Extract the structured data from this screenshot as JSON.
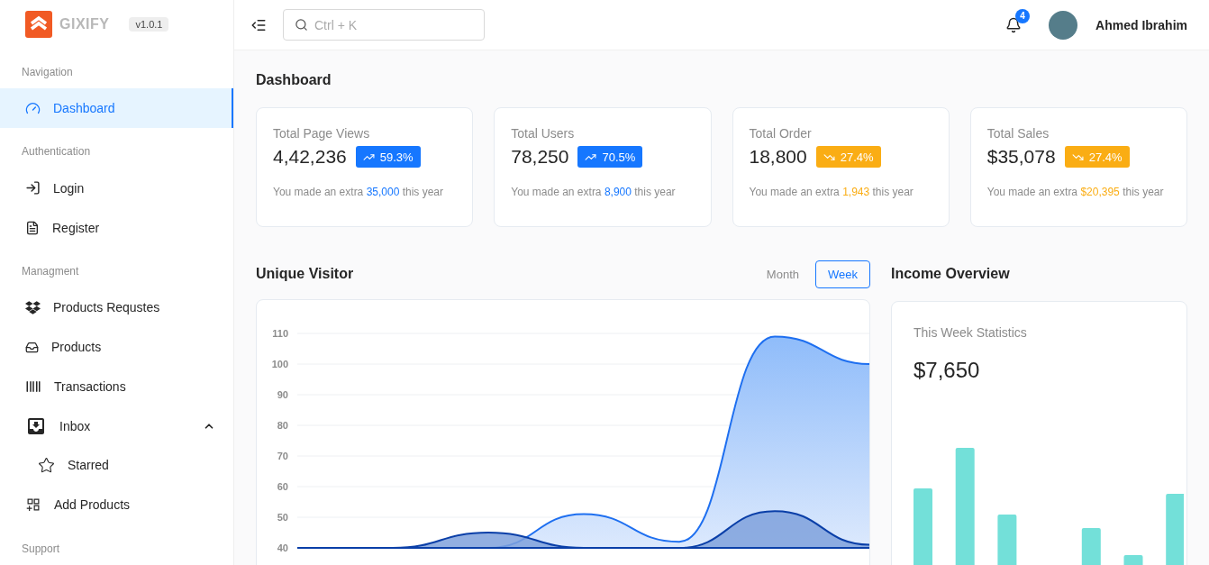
{
  "brand": {
    "name": "GIXIFY",
    "version": "v1.0.1"
  },
  "sidebar": {
    "sections": [
      {
        "title": "Navigation",
        "items": [
          {
            "label": "Dashboard",
            "selected": true
          }
        ]
      },
      {
        "title": "Authentication",
        "items": [
          {
            "label": "Login",
            "selected": false
          },
          {
            "label": "Register",
            "selected": false
          }
        ]
      },
      {
        "title": "Managment",
        "items": [
          {
            "label": "Products Requstes",
            "selected": false
          },
          {
            "label": "Products",
            "selected": false
          },
          {
            "label": "Transactions",
            "selected": false
          },
          {
            "label": "Inbox",
            "selected": false,
            "expanded": true,
            "children": [
              {
                "label": "Starred",
                "selected": false
              }
            ]
          },
          {
            "label": "Add Products",
            "selected": false
          }
        ]
      },
      {
        "title": "Support"
      }
    ]
  },
  "header": {
    "search": {
      "placeholder": "Ctrl + K"
    },
    "notifications": "4",
    "user": {
      "name": "Ahmed Ibrahim"
    }
  },
  "page_title": "Dashboard",
  "stats": [
    {
      "label": "Total Page Views",
      "value": "4,42,236",
      "change": "59.3%",
      "kind": "up",
      "note_prefix": "You made an extra",
      "note_value": "35,000",
      "note_suffix": "this year"
    },
    {
      "label": "Total Users",
      "value": "78,250",
      "change": "70.5%",
      "kind": "up",
      "note_prefix": "You made an extra",
      "note_value": "8,900",
      "note_suffix": "this year"
    },
    {
      "label": "Total Order",
      "value": "18,800",
      "change": "27.4%",
      "kind": "down",
      "note_prefix": "You made an extra",
      "note_value": "1,943",
      "note_suffix": "this year"
    },
    {
      "label": "Total Sales",
      "value": "$35,078",
      "change": "27.4%",
      "kind": "down",
      "note_prefix": "You made an extra",
      "note_value": "$20,395",
      "note_suffix": "this year"
    }
  ],
  "unique_visitor": {
    "title": "Unique Visitor",
    "tabs": [
      {
        "label": "Month",
        "selected": false
      },
      {
        "label": "Week",
        "selected": true
      }
    ],
    "chart_data": {
      "type": "area",
      "ylim": [
        40,
        110
      ],
      "yticks": [
        40,
        50,
        60,
        70,
        80,
        90,
        100,
        110
      ],
      "grid": true,
      "series": [
        {
          "color": "#1e6ff0",
          "values": [
            40,
            40,
            40,
            51,
            42,
            109,
            100
          ]
        },
        {
          "color": "#0a3fa8",
          "values": [
            40,
            40,
            45,
            40,
            40,
            52,
            41
          ]
        }
      ]
    }
  },
  "income": {
    "title": "Income Overview",
    "subtitle": "This Week Statistics",
    "value": "$7,650"
  }
}
